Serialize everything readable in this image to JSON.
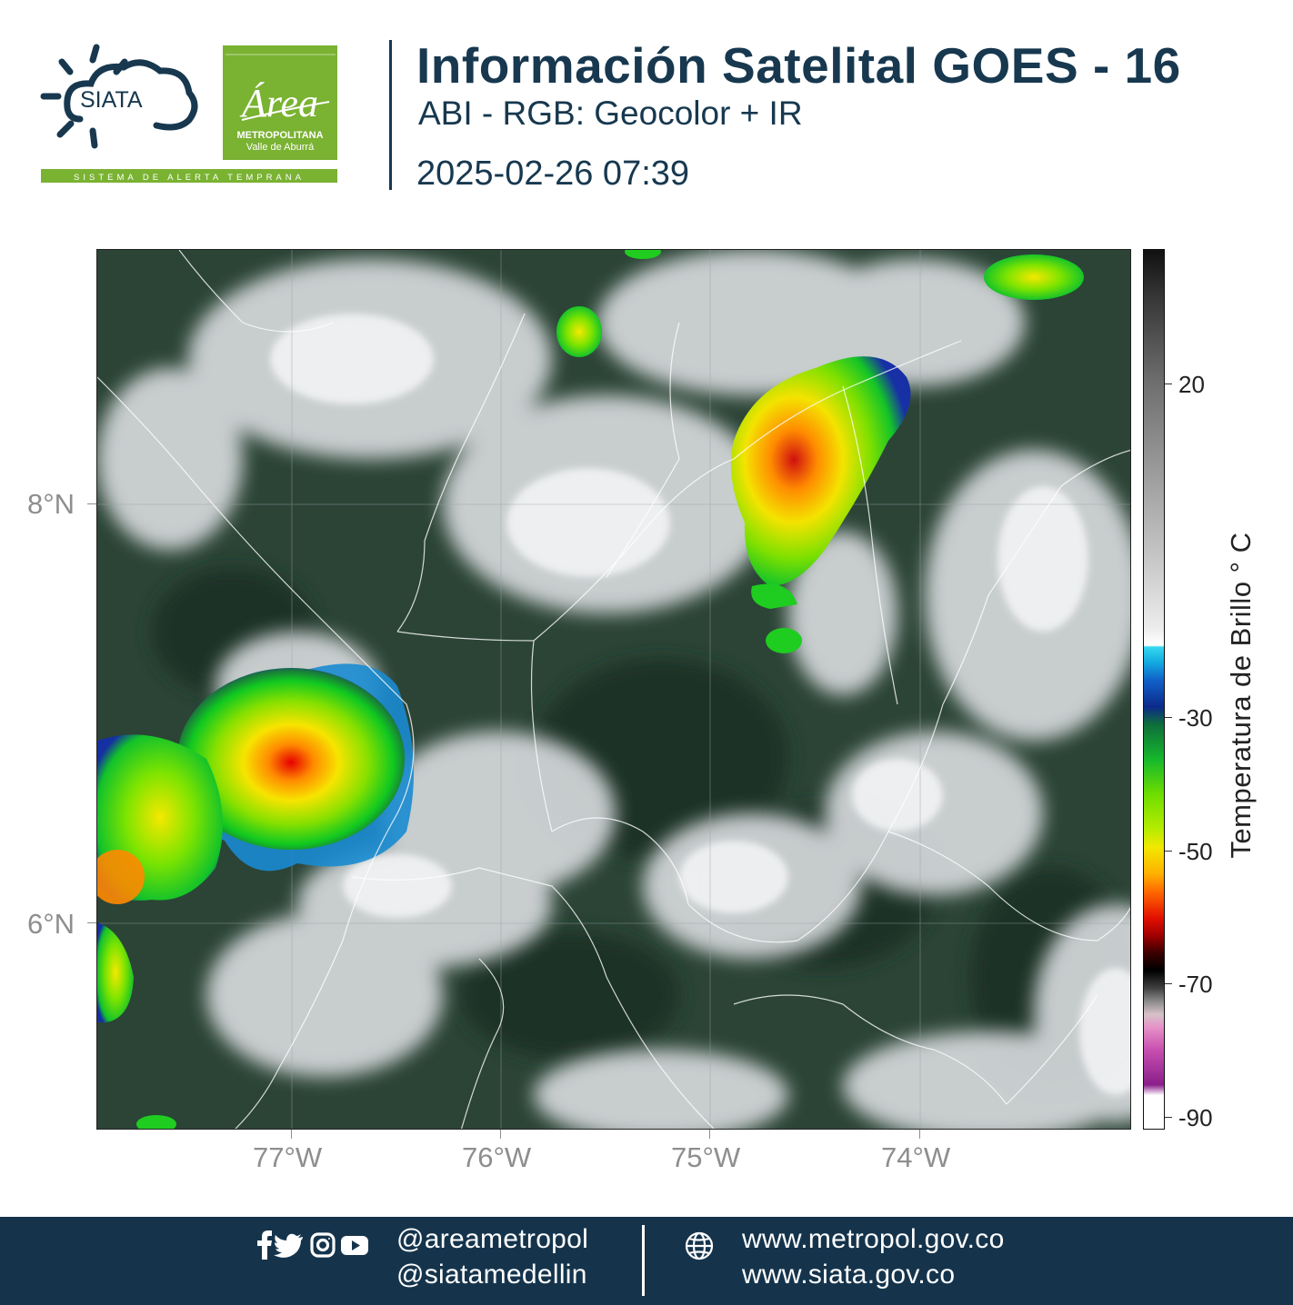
{
  "header": {
    "title": "Información Satelital GOES - 16",
    "subtitle": "ABI - RGB: Geocolor + IR",
    "timestamp": "2025-02-26 07:39"
  },
  "logos": {
    "siata_text": "SIATA",
    "siata_tagline": "SISTEMA DE ALERTA TEMPRANA",
    "area_script": "Área",
    "area_line1": "METROPOLITANA",
    "area_line2": "Valle de Aburrá",
    "brand_navy": "#17384f",
    "brand_green": "#7ab232"
  },
  "map": {
    "type": "satellite-imagery",
    "product": "GOES-16 ABI RGB Geocolor + IR",
    "lon_ticks": [
      "77°W",
      "76°W",
      "75°W",
      "74°W"
    ],
    "lat_ticks": [
      "8°N",
      "6°N"
    ],
    "lon_range": [
      -77.93,
      -72.97
    ],
    "lat_range": [
      4.85,
      9.07
    ]
  },
  "colorbar": {
    "title": "Temperatura de Brillo ° C",
    "ticks": [
      "20",
      "-30",
      "-50",
      "-70",
      "-90"
    ],
    "range": [
      -90,
      30
    ]
  },
  "footer": {
    "handle_1": "@areametropol",
    "handle_2": "@siatamedellin",
    "web_1": "www.metropol.gov.co",
    "web_2": "www.siata.gov.co",
    "icons": [
      "facebook-icon",
      "twitter-icon",
      "instagram-icon",
      "youtube-icon",
      "globe-icon"
    ]
  }
}
